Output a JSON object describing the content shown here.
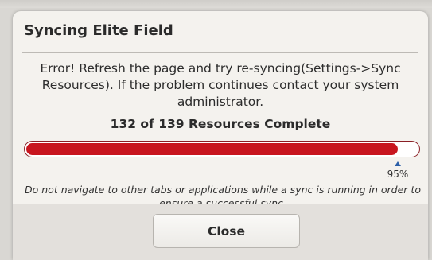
{
  "dialog": {
    "title": "Syncing Elite Field",
    "error_message": "Error! Refresh the page and try re-syncing(Settings->Sync Resources). If the problem continues contact your system administrator.",
    "progress_text": "132 of 139 Resources Complete",
    "progress": {
      "percent_label": "95%",
      "value": 0.95,
      "fill_color": "#c8161f"
    },
    "warning": "Do not navigate to other tabs or applications while a sync is running in order to ensure a successful sync.",
    "close_label": "Close"
  }
}
